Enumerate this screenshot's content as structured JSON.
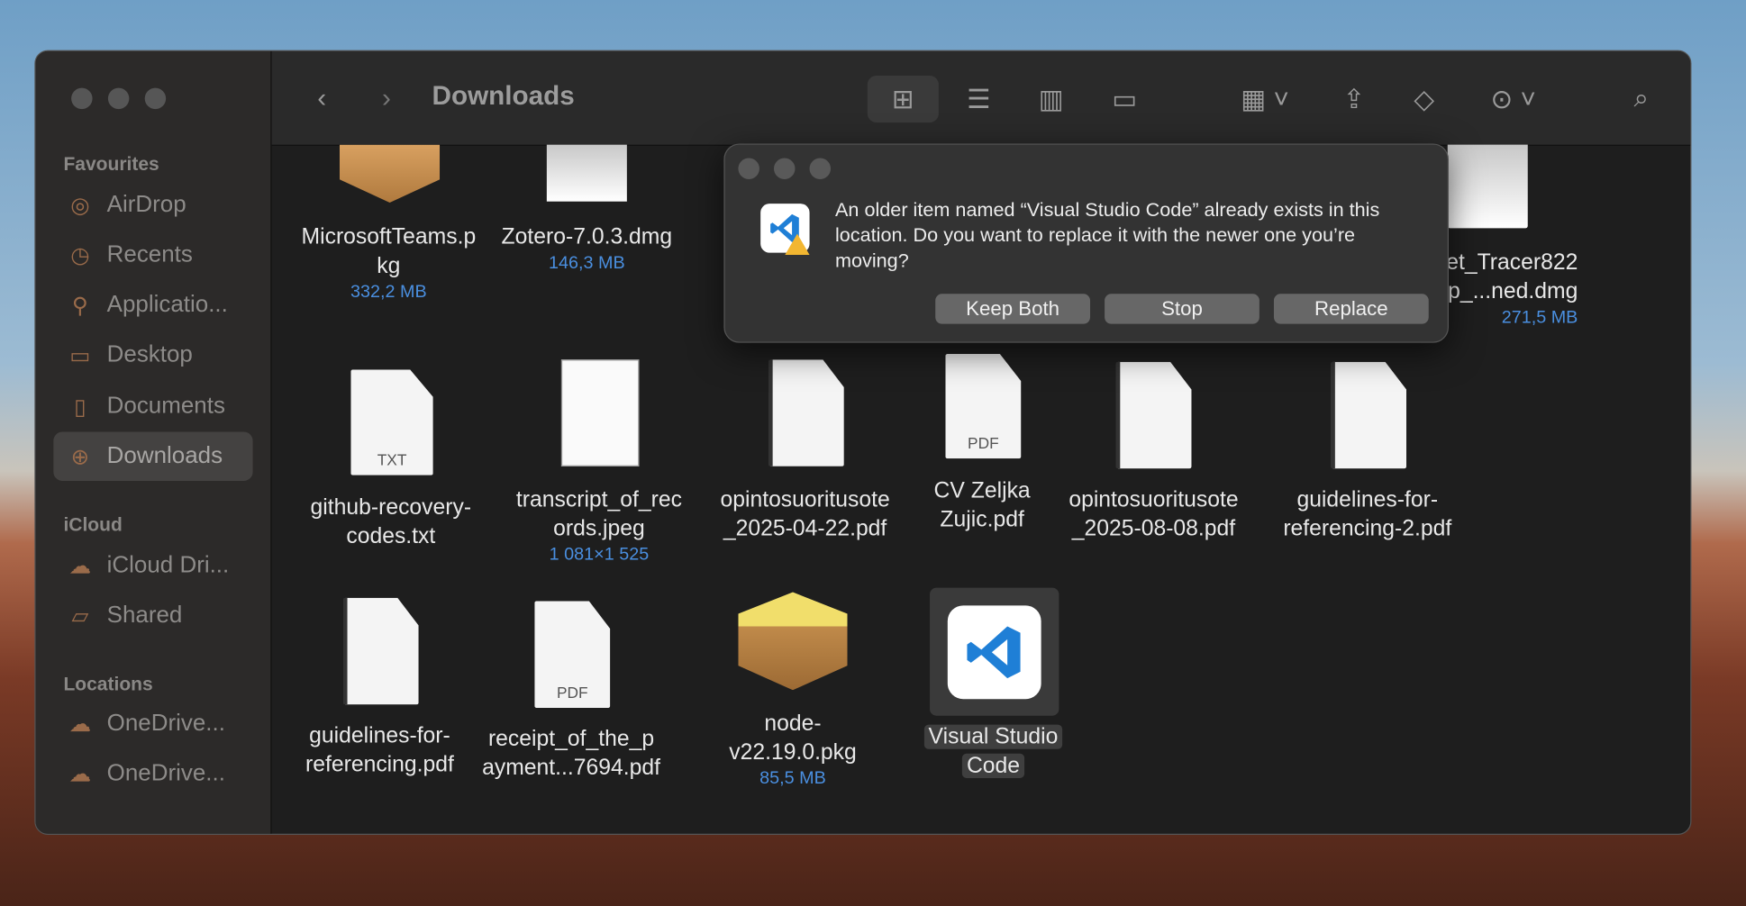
{
  "window": {
    "title": "Downloads"
  },
  "sidebar": {
    "sections": [
      "Favourites",
      "iCloud",
      "Locations"
    ],
    "items": [
      {
        "label": "AirDrop",
        "icon": "airdrop-icon"
      },
      {
        "label": "Recents",
        "icon": "clock-icon"
      },
      {
        "label": "Applicatio...",
        "icon": "applications-icon"
      },
      {
        "label": "Desktop",
        "icon": "desktop-icon"
      },
      {
        "label": "Documents",
        "icon": "document-icon"
      },
      {
        "label": "Downloads",
        "icon": "download-icon",
        "selected": true
      },
      {
        "label": "iCloud Dri...",
        "icon": "cloud-icon"
      },
      {
        "label": "Shared",
        "icon": "shared-folder-icon"
      },
      {
        "label": "OneDrive...",
        "icon": "cloud-icon"
      },
      {
        "label": "OneDrive...",
        "icon": "cloud-icon"
      }
    ]
  },
  "files": [
    {
      "l1": "MicrosoftTeams.p",
      "l2": "kg",
      "sub": "332,2 MB"
    },
    {
      "l1": "Zotero-7.0.3.dmg",
      "sub": "146,3 MB"
    },
    {
      "l1": "et_Tracer822",
      "l2": "p_...ned.dmg",
      "sub": "271,5 MB"
    },
    {
      "l1": "github-recovery-",
      "l2": "codes.txt",
      "badge": "TXT"
    },
    {
      "l1": "transcript_of_rec",
      "l2": "ords.jpeg",
      "sub": "1 081×1 525"
    },
    {
      "l1": "opintosuoritusote",
      "l2": "_2025-04-22.pdf"
    },
    {
      "l1": "CV Zeljka",
      "l2": "Zujic.pdf",
      "badge": "PDF"
    },
    {
      "l1": "opintosuoritusote",
      "l2": "_2025-08-08.pdf"
    },
    {
      "l1": "guidelines-for-",
      "l2": "referencing-2.pdf"
    },
    {
      "l1": "guidelines-for-",
      "l2": "referencing.pdf"
    },
    {
      "l1": "receipt_of_the_p",
      "l2": "ayment...7694.pdf",
      "badge": "PDF"
    },
    {
      "l1": "node-",
      "l2": "v22.19.0.pkg",
      "sub": "85,5 MB"
    },
    {
      "l1": "Visual Studio",
      "l2": "Code",
      "selected": true
    }
  ],
  "dialog": {
    "message": "An older item named “Visual Studio Code” already exists in this location. Do you want to replace it with the newer one you’re moving?",
    "buttons": [
      "Keep Both",
      "Stop",
      "Replace"
    ]
  },
  "colors": {
    "accent": "#4a8fe0",
    "sidebar_icon": "#9a6b4a"
  }
}
